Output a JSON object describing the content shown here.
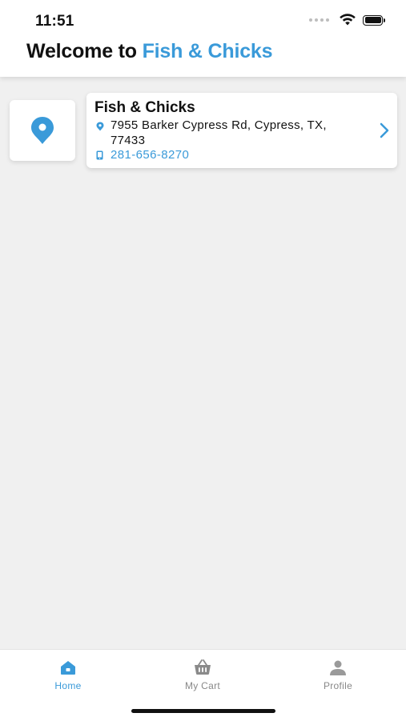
{
  "status_bar": {
    "time": "11:51"
  },
  "header": {
    "welcome_prefix": "Welcome to ",
    "brand": "Fish & Chicks"
  },
  "stores": [
    {
      "name": "Fish & Chicks",
      "address": "7955 Barker Cypress Rd, Cypress, TX, 77433",
      "phone": "281-656-8270",
      "icon": "location-pin-icon"
    }
  ],
  "tabbar": {
    "tabs": [
      {
        "label": "Home",
        "icon": "home-icon",
        "active": true
      },
      {
        "label": "My Cart",
        "icon": "basket-icon",
        "active": false
      },
      {
        "label": "Profile",
        "icon": "person-icon",
        "active": false
      }
    ]
  },
  "colors": {
    "accent": "#3a9ad9",
    "background": "#f0f0f0",
    "inactive": "#888888"
  }
}
